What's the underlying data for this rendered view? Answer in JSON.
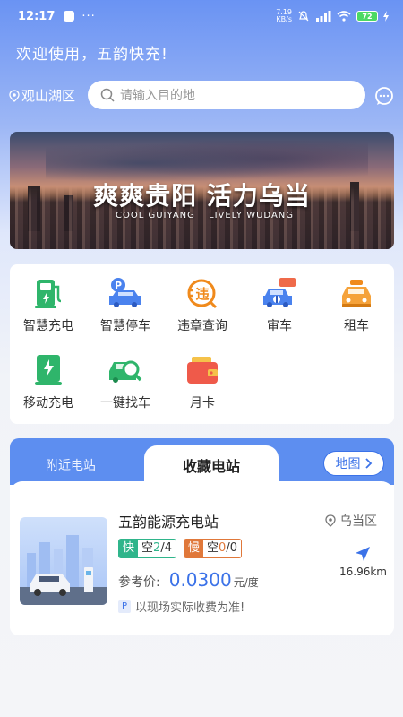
{
  "status_bar": {
    "time": "12:17",
    "more": "···",
    "net_speed_top": "7.19",
    "net_speed_bottom": "KB/s",
    "battery": "72"
  },
  "header": {
    "welcome": "欢迎使用，五韵快充!"
  },
  "location": {
    "district": "观山湖区"
  },
  "search": {
    "placeholder": "请输入目的地"
  },
  "banner": {
    "title": "爽爽贵阳 活力乌当",
    "sub_left": "COOL GUIYANG",
    "sub_right": "LIVELY WUDANG"
  },
  "functions": [
    {
      "label": "智慧充电",
      "icon": "charging-pile-icon"
    },
    {
      "label": "智慧停车",
      "icon": "parking-car-icon"
    },
    {
      "label": "违章查询",
      "icon": "violation-query-icon"
    },
    {
      "label": "审车",
      "icon": "car-inspection-icon"
    },
    {
      "label": "租车",
      "icon": "car-rental-icon"
    },
    {
      "label": "移动充电",
      "icon": "mobile-charging-icon"
    },
    {
      "label": "一键找车",
      "icon": "find-car-icon"
    },
    {
      "label": "月卡",
      "icon": "monthly-card-icon"
    }
  ],
  "station_tabs": {
    "nearby": "附近电站",
    "favorites": "收藏电站",
    "map": "地图"
  },
  "station": {
    "name": "五韵能源充电站",
    "area": "乌当区",
    "fast_label": "快",
    "fast_free_label": "空",
    "fast_free": "2",
    "fast_total": "/4",
    "slow_label": "慢",
    "slow_free_label": "空",
    "slow_free": "0",
    "slow_total": "/0",
    "price_label": "参考价:",
    "price": "0.0300",
    "price_unit": "元/度",
    "distance": "16.96km",
    "note_tag": "P",
    "note": "以现场实际收费为准!"
  },
  "colors": {
    "accent": "#3b72e8",
    "tab_bar": "#5d8ef0",
    "fast": "#2fb58b",
    "slow": "#e0783a"
  }
}
